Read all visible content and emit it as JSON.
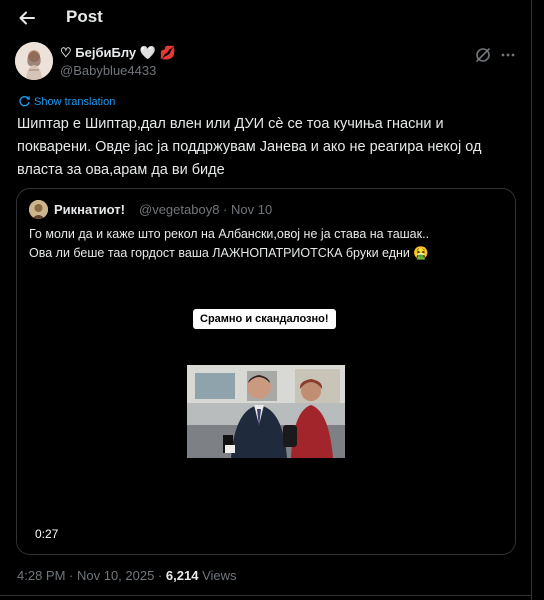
{
  "header": {
    "title": "Post"
  },
  "author": {
    "name": "♡ БејбиБлу",
    "name_emoji": "🤍 💋",
    "handle": "@Babyblue4433"
  },
  "translate_label": "Show translation",
  "tweet": {
    "text": "Шиптар е Шиптар,дал влен или ДУИ сè се тоа кучиња гнасни и покварени. Овде јас ја поддржувам Јанева и ако не реагира некој од власта за ова,арам да ви биде"
  },
  "quote": {
    "name": "Рикнатиот!",
    "handle": "@vegetaboy8",
    "date": "· Nov 10",
    "line1": "Го моли да и каже што рекол на Албански,овој не ја става на ташак..",
    "line2": "Ова ли беше таа гордост ваша ЛАЖНОПАТРИОТСКА бруки едни 🤮",
    "video": {
      "caption": "Срамно и скандалозно!",
      "duration": "0:27"
    }
  },
  "meta": {
    "time": "4:28 PM",
    "date": "· Nov 10, 2025 ·",
    "views_count": "6,214",
    "views_label": "Views"
  },
  "colors": {
    "background": "#000000",
    "text": "#e7e9ea",
    "secondary": "#71767b",
    "link": "#1d9bf0",
    "border": "#2f3336"
  },
  "icons": {
    "back": "arrow-left-icon",
    "grok": "grok-icon",
    "more": "more-horizontal-icon",
    "translate": "translate-icon"
  }
}
